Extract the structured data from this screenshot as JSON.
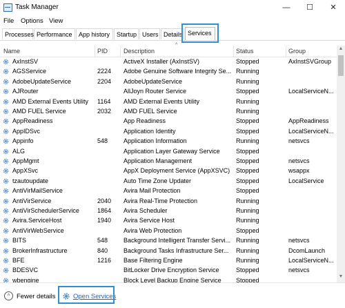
{
  "window": {
    "title": "Task Manager",
    "minimize": "—",
    "maximize": "☐",
    "close": "✕"
  },
  "menu": [
    "File",
    "Options",
    "View"
  ],
  "tabs": [
    "Processes",
    "Performance",
    "App history",
    "Startup",
    "Users",
    "Details",
    "Services"
  ],
  "active_tab": "Services",
  "columns": {
    "name": "Name",
    "pid": "PID",
    "description": "Description",
    "status": "Status",
    "group": "Group"
  },
  "services": [
    {
      "name": "AxInstSV",
      "pid": "",
      "description": "ActiveX Installer (AxInstSV)",
      "status": "Stopped",
      "group": "AxInstSVGroup"
    },
    {
      "name": "AGSService",
      "pid": "2224",
      "description": "Adobe Genuine Software Integrity Se...",
      "status": "Running",
      "group": ""
    },
    {
      "name": "AdobeUpdateService",
      "pid": "2204",
      "description": "AdobeUpdateService",
      "status": "Running",
      "group": ""
    },
    {
      "name": "AJRouter",
      "pid": "",
      "description": "AllJoyn Router Service",
      "status": "Stopped",
      "group": "LocalServiceN..."
    },
    {
      "name": "AMD External Events Utility",
      "pid": "1164",
      "description": "AMD External Events Utility",
      "status": "Running",
      "group": ""
    },
    {
      "name": "AMD FUEL Service",
      "pid": "2032",
      "description": "AMD FUEL Service",
      "status": "Running",
      "group": ""
    },
    {
      "name": "AppReadiness",
      "pid": "",
      "description": "App Readiness",
      "status": "Stopped",
      "group": "AppReadiness"
    },
    {
      "name": "AppIDSvc",
      "pid": "",
      "description": "Application Identity",
      "status": "Stopped",
      "group": "LocalServiceN..."
    },
    {
      "name": "Appinfo",
      "pid": "548",
      "description": "Application Information",
      "status": "Running",
      "group": "netsvcs"
    },
    {
      "name": "ALG",
      "pid": "",
      "description": "Application Layer Gateway Service",
      "status": "Stopped",
      "group": ""
    },
    {
      "name": "AppMgmt",
      "pid": "",
      "description": "Application Management",
      "status": "Stopped",
      "group": "netsvcs"
    },
    {
      "name": "AppXSvc",
      "pid": "",
      "description": "AppX Deployment Service (AppXSVC)",
      "status": "Stopped",
      "group": "wsappx"
    },
    {
      "name": "tzautoupdate",
      "pid": "",
      "description": "Auto Time Zone Updater",
      "status": "Stopped",
      "group": "LocalService"
    },
    {
      "name": "AntiVirMailService",
      "pid": "",
      "description": "Avira Mail Protection",
      "status": "Stopped",
      "group": ""
    },
    {
      "name": "AntiVirService",
      "pid": "2040",
      "description": "Avira Real-Time Protection",
      "status": "Running",
      "group": ""
    },
    {
      "name": "AntiVirSchedulerService",
      "pid": "1864",
      "description": "Avira Scheduler",
      "status": "Running",
      "group": ""
    },
    {
      "name": "Avira.ServiceHost",
      "pid": "1940",
      "description": "Avira Service Host",
      "status": "Running",
      "group": ""
    },
    {
      "name": "AntiVirWebService",
      "pid": "",
      "description": "Avira Web Protection",
      "status": "Stopped",
      "group": ""
    },
    {
      "name": "BITS",
      "pid": "548",
      "description": "Background Intelligent Transfer Servi...",
      "status": "Running",
      "group": "netsvcs"
    },
    {
      "name": "BrokerInfrastructure",
      "pid": "840",
      "description": "Background Tasks Infrastructure Ser...",
      "status": "Running",
      "group": "DcomLaunch"
    },
    {
      "name": "BFE",
      "pid": "1216",
      "description": "Base Filtering Engine",
      "status": "Running",
      "group": "LocalServiceN..."
    },
    {
      "name": "BDESVC",
      "pid": "",
      "description": "BitLocker Drive Encryption Service",
      "status": "Stopped",
      "group": "netsvcs"
    },
    {
      "name": "wbengine",
      "pid": "",
      "description": "Block Level Backup Engine Service",
      "status": "Stopped",
      "group": ""
    }
  ],
  "footer": {
    "fewer_details": "Fewer details",
    "open_services": "Open Services"
  },
  "colors": {
    "highlight": "#2f8fd1",
    "link": "#1a62c7",
    "gear_icon": "#5a8fc7"
  },
  "icons": {
    "app": "task-manager-icon",
    "service": "gear-icon",
    "fewer": "chevron-up-icon"
  }
}
